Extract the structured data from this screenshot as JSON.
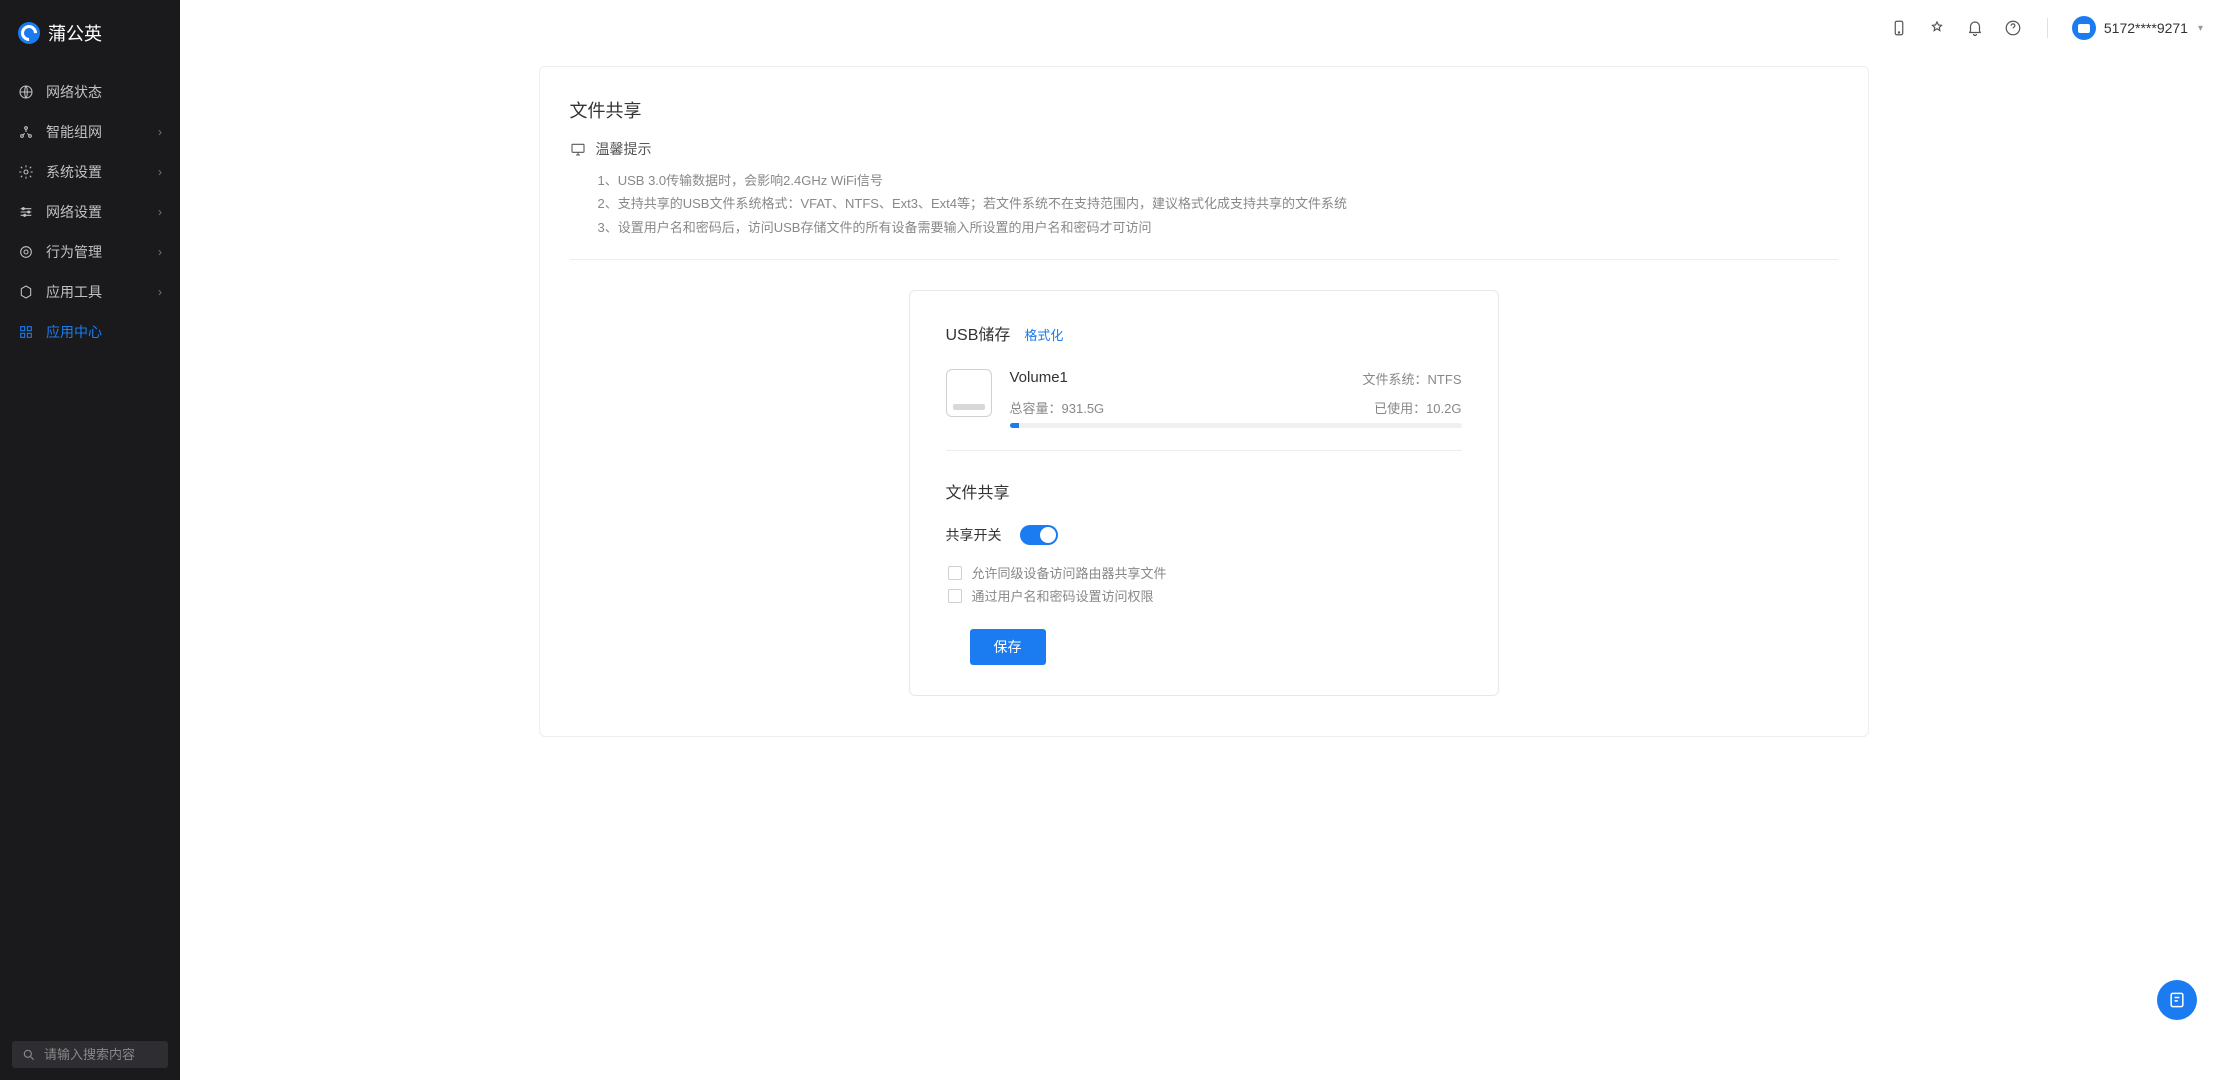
{
  "brand": {
    "name": "蒲公英"
  },
  "sidebar": {
    "items": [
      {
        "label": "网络状态",
        "expandable": false
      },
      {
        "label": "智能组网",
        "expandable": true
      },
      {
        "label": "系统设置",
        "expandable": true
      },
      {
        "label": "网络设置",
        "expandable": true
      },
      {
        "label": "行为管理",
        "expandable": true
      },
      {
        "label": "应用工具",
        "expandable": true
      },
      {
        "label": "应用中心",
        "expandable": false,
        "active": true
      }
    ],
    "search_placeholder": "请输入搜索内容"
  },
  "topbar": {
    "user_label": "5172****9271"
  },
  "page": {
    "title": "文件共享",
    "tip_title": "温馨提示",
    "tips": [
      "1、USB 3.0传输数据时，会影响2.4GHz WiFi信号",
      "2、支持共享的USB文件系统格式：VFAT、NTFS、Ext3、Ext4等；若文件系统不在支持范围内，建议格式化成支持共享的文件系统",
      "3、设置用户名和密码后，访问USB存储文件的所有设备需要输入所设置的用户名和密码才可访问"
    ]
  },
  "storage": {
    "section_title": "USB储存",
    "format_link": "格式化",
    "volume_name": "Volume1",
    "fs_label": "文件系统：",
    "fs_value": "NTFS",
    "total_label": "总容量：",
    "total_value": "931.5G",
    "used_label": "已使用：",
    "used_value": "10.2G"
  },
  "share": {
    "section_title": "文件共享",
    "switch_label": "共享开关",
    "switch_on": true,
    "opt1": "允许同级设备访问路由器共享文件",
    "opt2": "通过用户名和密码设置访问权限",
    "save_label": "保存"
  }
}
